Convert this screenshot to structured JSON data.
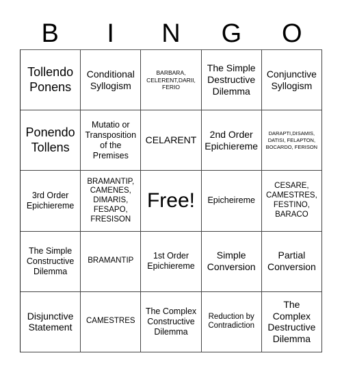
{
  "header": [
    "B",
    "I",
    "N",
    "G",
    "O"
  ],
  "cells": [
    [
      "Tollendo Ponens",
      "Conditional Syllogism",
      "BARBARA, CELERENT,DARII, FERIO",
      "The Simple Destructive Dilemma",
      "Conjunctive Syllogism"
    ],
    [
      "Ponendo Tollens",
      "Mutatio or Transposition of the Premises",
      "CELARENT",
      "2nd Order Epichiereme",
      "DARAPTI,DISAMIS, DATISI, FELAPTON, BOCARDO, FERISON"
    ],
    [
      "3rd Order Epichiereme",
      "BRAMANTIP, CAMENES, DIMARIS, FESAPO, FRESISON",
      "Free!",
      "Epicheireme",
      "CESARE, CAMESTRES, FESTINO, BARACO"
    ],
    [
      "The Simple Constructive Dilemma",
      "BRAMANTIP",
      "1st Order Epichiereme",
      "Simple Conversion",
      "Partial Conversion"
    ],
    [
      "Disjunctive Statement",
      "CAMESTRES",
      "The Complex Constructive Dilemma",
      "Reduction by Contradiction",
      "The Complex Destructive Dilemma"
    ]
  ]
}
